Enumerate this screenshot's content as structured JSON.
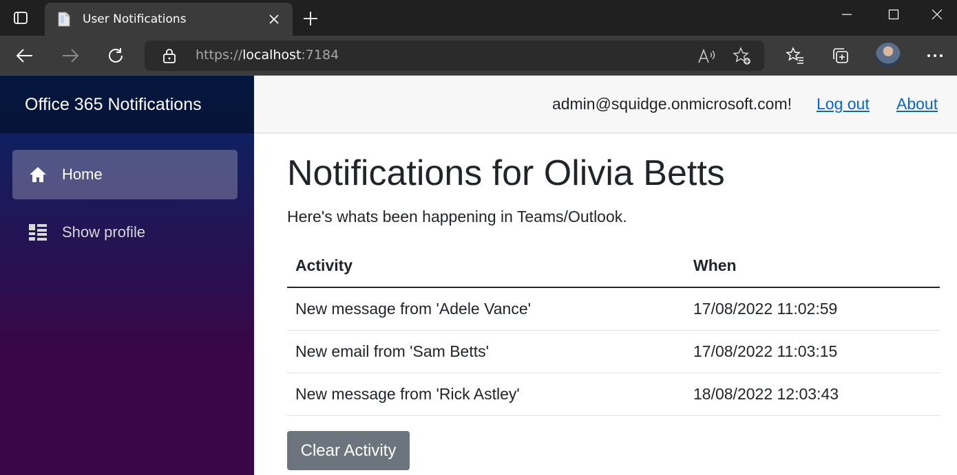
{
  "browser": {
    "tab_title": "User Notifications",
    "url_scheme": "https://",
    "url_host": "localhost",
    "url_port": ":7184",
    "icons": {
      "tab_actions": "tab-actions-icon",
      "favicon": "page-icon",
      "close_tab": "close-icon",
      "new_tab": "plus-icon",
      "back": "back-arrow-icon",
      "forward": "forward-arrow-icon",
      "refresh": "refresh-icon",
      "lock": "lock-icon",
      "read_aloud": "read-aloud-icon",
      "add_favorite": "star-plus-icon",
      "favorites": "favorites-icon",
      "collections": "collections-icon",
      "menu": "more-icon"
    }
  },
  "sidebar": {
    "brand": "Office 365 Notifications",
    "items": [
      {
        "label": "Home",
        "icon": "home-icon",
        "active": true
      },
      {
        "label": "Show profile",
        "icon": "list-icon",
        "active": false
      }
    ]
  },
  "header": {
    "user": "admin@squidge.onmicrosoft.com!",
    "logout": "Log out",
    "about": "About"
  },
  "main": {
    "title": "Notifications for Olivia Betts",
    "subtitle": "Here's whats been happening in Teams/Outlook.",
    "table": {
      "columns": [
        "Activity",
        "When"
      ],
      "rows": [
        [
          "New message from 'Adele Vance'",
          "17/08/2022 11:02:59"
        ],
        [
          "New email from 'Sam Betts'",
          "17/08/2022 11:03:15"
        ],
        [
          "New message from 'Rick Astley'",
          "18/08/2022 12:03:43"
        ]
      ]
    },
    "clear_button": "Clear Activity"
  },
  "colors": {
    "sidebar_top": "#052767",
    "sidebar_bottom": "#3a0647",
    "link": "#0366d6",
    "button": "#6c757d"
  }
}
